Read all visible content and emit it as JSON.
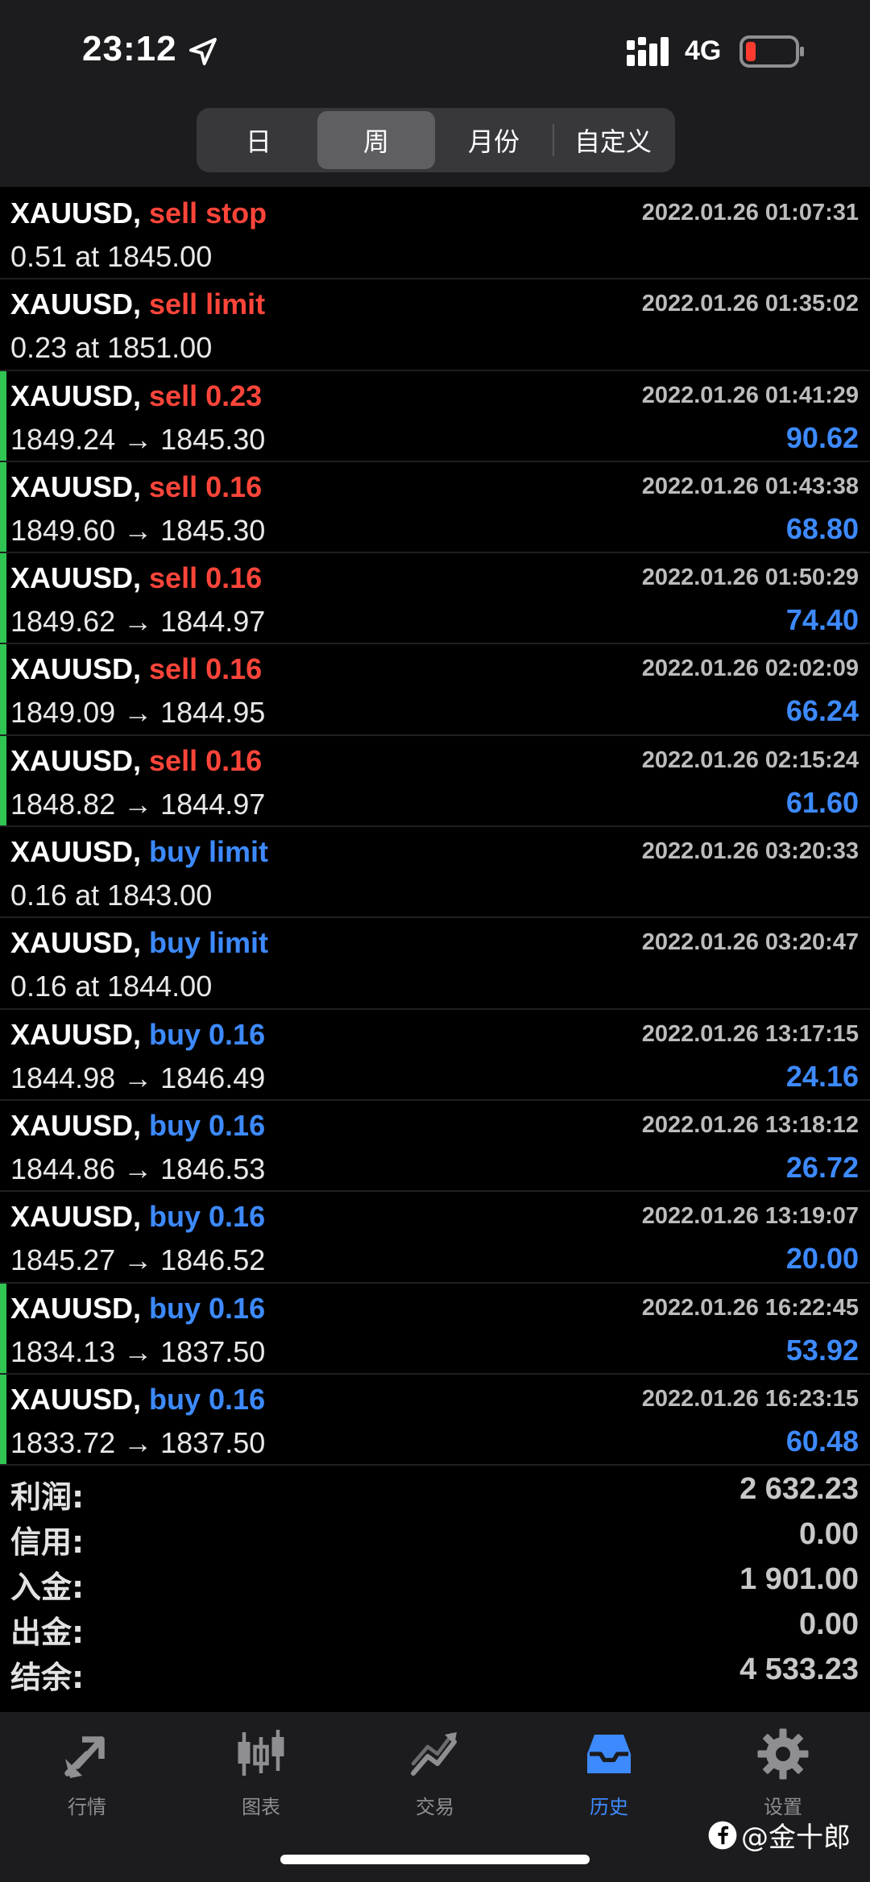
{
  "status_bar": {
    "time": "23:12",
    "network": "4G"
  },
  "period_tabs": [
    {
      "label": "日",
      "active": false
    },
    {
      "label": "周",
      "active": true
    },
    {
      "label": "月份",
      "active": false
    },
    {
      "label": "自定义",
      "active": false
    }
  ],
  "rows": [
    {
      "symbol": "XAUUSD,",
      "action": "sell stop",
      "side": "sell",
      "detail": "0.51 at 1845.00",
      "time": "2022.01.26 01:07:31",
      "profit": "",
      "closed": false
    },
    {
      "symbol": "XAUUSD,",
      "action": "sell limit",
      "side": "sell",
      "detail": "0.23 at 1851.00",
      "time": "2022.01.26 01:35:02",
      "profit": "",
      "closed": false
    },
    {
      "symbol": "XAUUSD,",
      "action": "sell 0.23",
      "side": "sell",
      "detail": "1849.24 → 1845.30",
      "time": "2022.01.26 01:41:29",
      "profit": "90.62",
      "closed": true
    },
    {
      "symbol": "XAUUSD,",
      "action": "sell 0.16",
      "side": "sell",
      "detail": "1849.60 → 1845.30",
      "time": "2022.01.26 01:43:38",
      "profit": "68.80",
      "closed": true
    },
    {
      "symbol": "XAUUSD,",
      "action": "sell 0.16",
      "side": "sell",
      "detail": "1849.62 → 1844.97",
      "time": "2022.01.26 01:50:29",
      "profit": "74.40",
      "closed": true
    },
    {
      "symbol": "XAUUSD,",
      "action": "sell 0.16",
      "side": "sell",
      "detail": "1849.09 → 1844.95",
      "time": "2022.01.26 02:02:09",
      "profit": "66.24",
      "closed": true
    },
    {
      "symbol": "XAUUSD,",
      "action": "sell 0.16",
      "side": "sell",
      "detail": "1848.82 → 1844.97",
      "time": "2022.01.26 02:15:24",
      "profit": "61.60",
      "closed": true
    },
    {
      "symbol": "XAUUSD,",
      "action": "buy limit",
      "side": "buy",
      "detail": "0.16 at 1843.00",
      "time": "2022.01.26 03:20:33",
      "profit": "",
      "closed": false
    },
    {
      "symbol": "XAUUSD,",
      "action": "buy limit",
      "side": "buy",
      "detail": "0.16 at 1844.00",
      "time": "2022.01.26 03:20:47",
      "profit": "",
      "closed": false
    },
    {
      "symbol": "XAUUSD,",
      "action": "buy 0.16",
      "side": "buy",
      "detail": "1844.98 → 1846.49",
      "time": "2022.01.26 13:17:15",
      "profit": "24.16",
      "closed": false
    },
    {
      "symbol": "XAUUSD,",
      "action": "buy 0.16",
      "side": "buy",
      "detail": "1844.86 → 1846.53",
      "time": "2022.01.26 13:18:12",
      "profit": "26.72",
      "closed": false
    },
    {
      "symbol": "XAUUSD,",
      "action": "buy 0.16",
      "side": "buy",
      "detail": "1845.27 → 1846.52",
      "time": "2022.01.26 13:19:07",
      "profit": "20.00",
      "closed": false
    },
    {
      "symbol": "XAUUSD,",
      "action": "buy 0.16",
      "side": "buy",
      "detail": "1834.13 → 1837.50",
      "time": "2022.01.26 16:22:45",
      "profit": "53.92",
      "closed": true
    },
    {
      "symbol": "XAUUSD,",
      "action": "buy 0.16",
      "side": "buy",
      "detail": "1833.72 → 1837.50",
      "time": "2022.01.26 16:23:15",
      "profit": "60.48",
      "closed": true
    }
  ],
  "summary": [
    {
      "label": "利润:",
      "value": "2 632.23"
    },
    {
      "label": "信用:",
      "value": "0.00"
    },
    {
      "label": "入金:",
      "value": "1 901.00"
    },
    {
      "label": "出金:",
      "value": "0.00"
    },
    {
      "label": "结余:",
      "value": "4 533.23"
    }
  ],
  "tabbar": [
    {
      "label": "行情",
      "icon": "quotes-icon",
      "active": false
    },
    {
      "label": "图表",
      "icon": "candlestick-chart-icon",
      "active": false
    },
    {
      "label": "交易",
      "icon": "trade-icon",
      "active": false
    },
    {
      "label": "历史",
      "icon": "history-inbox-icon",
      "active": true
    },
    {
      "label": "设置",
      "icon": "settings-gear-icon",
      "active": false
    }
  ],
  "watermark": "@金十郎",
  "colors": {
    "sell": "#ff453a",
    "buy": "#3d8aff",
    "profit": "#3d8aff",
    "closed_marker": "#30c452",
    "active_tab": "#3d8aff"
  }
}
